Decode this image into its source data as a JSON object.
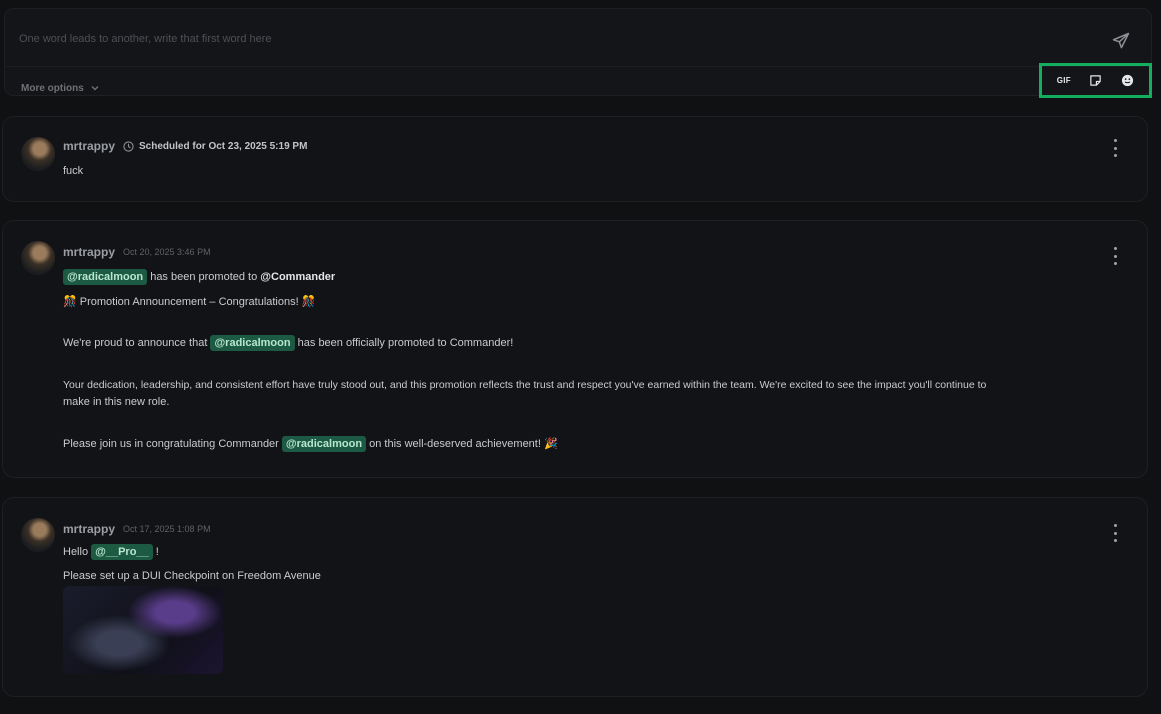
{
  "composer": {
    "placeholder": "One word leads to another, write that first word here",
    "more_options_label": "More options",
    "toolbar": {
      "gif_label": "GIF",
      "icons": [
        "gif-button",
        "sticker-icon",
        "emoji-icon"
      ]
    },
    "highlight_color": "#12b05e"
  },
  "posts": [
    {
      "username": "mrtrappy",
      "scheduled_label": "Scheduled for Oct 23, 2025 5:19 PM",
      "lines": [
        "fuck"
      ]
    },
    {
      "username": "mrtrappy",
      "timestamp": "Oct 20, 2025 3:46 PM",
      "line1_mention": "@radicalmoon",
      "line1_text": " has been promoted to ",
      "line1_role": "@Commander",
      "line2": "🎊 Promotion Announcement – Congratulations! 🎊",
      "line3_before": "We're proud to announce that ",
      "line3_mention": "@radicalmoon",
      "line3_after": " has been officially promoted to Commander!",
      "line4": "Your dedication, leadership, and consistent effort have truly stood out, and this promotion reflects the trust and respect you've earned within the team. We're excited to see the impact you'll continue to",
      "line5": "make in this new role.",
      "line6_before": "Please join us in congratulating Commander ",
      "line6_mention": "@radicalmoon",
      "line6_after": " on this well-deserved achievement! 🎉"
    },
    {
      "username": "mrtrappy",
      "timestamp": "Oct 17, 2025 1:08 PM",
      "line1_prefix": "Hello ",
      "line1_mention": "@__Pro__",
      "line1_suffix": " !",
      "line2": "Please set up a DUI Checkpoint on Freedom Avenue"
    }
  ]
}
